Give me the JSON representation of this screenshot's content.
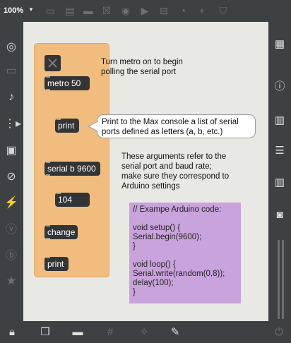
{
  "toolbar": {
    "zoom": "100%",
    "icons": [
      "presentation-icon",
      "message-icon",
      "comment-icon",
      "toggle-icon",
      "button-icon",
      "play-icon",
      "slider-icon",
      "dial-icon",
      "plus-icon",
      "paint-bucket-icon"
    ]
  },
  "left_sidebar": {
    "icons": [
      "target-icon",
      "film-icon",
      "music-note-icon",
      "sequence-icon",
      "image-icon",
      "paperclip-icon",
      "plug-icon",
      "vimeo-icon",
      "bold-icon",
      "star-icon"
    ]
  },
  "right_sidebar": {
    "icons": [
      "grid-icon",
      "info-icon",
      "book-icon",
      "list-icon",
      "book-icon",
      "camera-icon"
    ]
  },
  "bottom_bar": {
    "icons": [
      "lock-icon",
      "windows-icon",
      "presentation-icon",
      "grid-icon",
      "wand-icon",
      "wrench-icon",
      "power-icon"
    ]
  },
  "patch": {
    "objects": {
      "toggle": "x",
      "metro": "metro 50",
      "print1": "print",
      "serial": "serial b 9600",
      "number": "104",
      "change": "change",
      "print2": "print"
    },
    "comments": {
      "metro_note": "Turn metro on to begin\npolling the serial port",
      "print_note": "Print to the Max console a list of serial ports defined as letters (a, b, etc.)",
      "args_note": "These arguments refer to the\nserial port and baud rate;\nmake sure they correspond to\nArduino settings"
    },
    "code": "// Exampe Arduino code:\n\nvoid setup() {\nSerial.begin(9600);\n}\n\nvoid loop() {\nSerial.write(random(0,8));\ndelay(100);\n}"
  },
  "colors": {
    "background": "#3e4144",
    "canvas": "#e8e8e5",
    "panel": "#f0bd7e",
    "object": "#333436",
    "code_bg": "#c9a3dc"
  }
}
